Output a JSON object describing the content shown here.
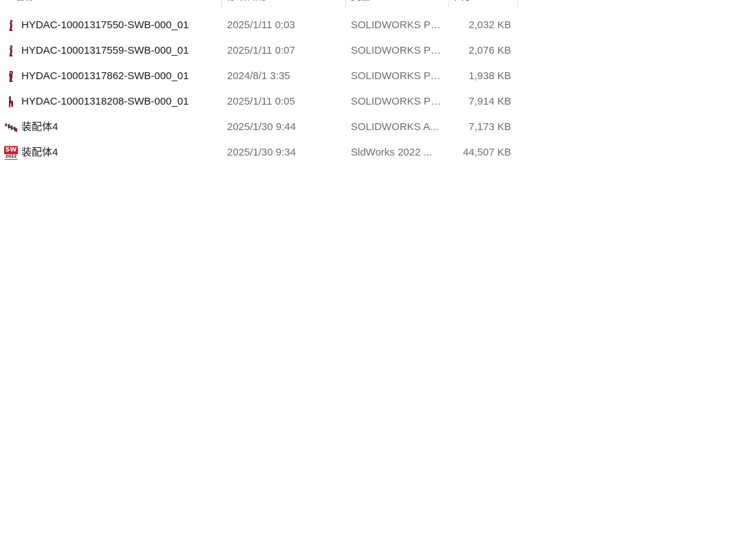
{
  "columns": {
    "name": "名称",
    "date": "修改日期",
    "type": "类型",
    "size": "大小"
  },
  "files": [
    {
      "name": "HYDAC-10001317550-SWB-000_01",
      "date": "2025/1/11 0:03",
      "type": "SOLIDWORKS Pa...",
      "size": "2,032 KB",
      "icon": "solidworks-part-icon"
    },
    {
      "name": "HYDAC-10001317559-SWB-000_01",
      "date": "2025/1/11 0:07",
      "type": "SOLIDWORKS Pa...",
      "size": "2,076 KB",
      "icon": "solidworks-part-icon"
    },
    {
      "name": "HYDAC-10001317862-SWB-000_01",
      "date": "2024/8/1 3:35",
      "type": "SOLIDWORKS Pa...",
      "size": "1,938 KB",
      "icon": "solidworks-part-icon"
    },
    {
      "name": "HYDAC-10001318208-SWB-000_01",
      "date": "2025/1/11 0:05",
      "type": "SOLIDWORKS Pa...",
      "size": "7,914 KB",
      "icon": "solidworks-part-icon"
    },
    {
      "name": "装配体4",
      "date": "2025/1/30 9:44",
      "type": "SOLIDWORKS A...",
      "size": "7,173 KB",
      "icon": "solidworks-assembly-icon"
    },
    {
      "name": "装配体4",
      "date": "2025/1/30 9:34",
      "type": "SldWorks 2022 ...",
      "size": "44,507 KB",
      "icon": "sldworks-2022-icon",
      "badge": {
        "top": "SW",
        "bottom": "2022"
      }
    }
  ],
  "colors": {
    "part_icon": "#7a1f2b",
    "sw_red": "#d42027",
    "header_text": "#4c607a",
    "secondary_text": "#6d6d6d"
  }
}
